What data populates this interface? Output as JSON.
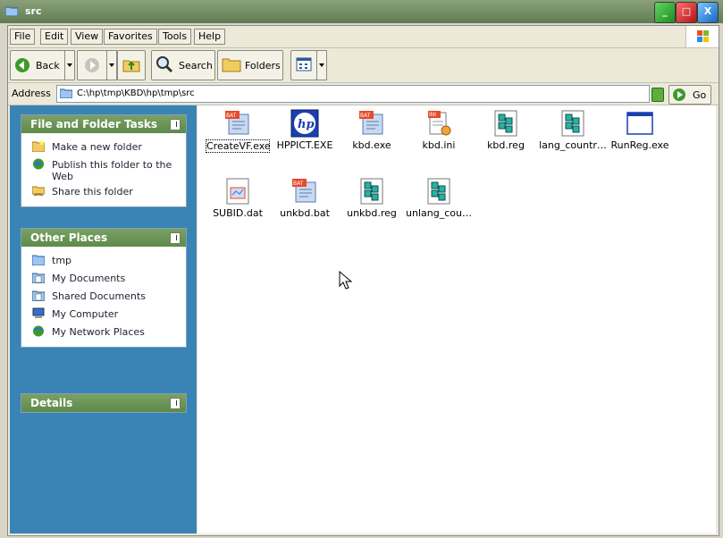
{
  "window": {
    "title": "src"
  },
  "menu": [
    "File",
    "Edit",
    "View",
    "Favorites",
    "Tools",
    "Help"
  ],
  "toolbar": {
    "back_label": "Back",
    "search_label": "Search",
    "folders_label": "Folders"
  },
  "address": {
    "label": "Address",
    "path": "C:\\hp\\tmp\\KBD\\hp\\tmp\\src",
    "go_label": "Go"
  },
  "panels": {
    "tasks": {
      "title": "File and Folder Tasks",
      "items": [
        {
          "label": "Make a new folder",
          "icon": "new-folder-icon"
        },
        {
          "label": "Publish this folder to the Web",
          "icon": "publish-web-icon"
        },
        {
          "label": "Share this folder",
          "icon": "share-folder-icon"
        }
      ]
    },
    "places": {
      "title": "Other Places",
      "items": [
        {
          "label": "tmp",
          "icon": "folder-icon"
        },
        {
          "label": "My Documents",
          "icon": "my-documents-icon"
        },
        {
          "label": "Shared Documents",
          "icon": "shared-documents-icon"
        },
        {
          "label": "My Computer",
          "icon": "my-computer-icon"
        },
        {
          "label": "My Network Places",
          "icon": "network-places-icon"
        }
      ]
    },
    "details": {
      "title": "Details"
    }
  },
  "files": [
    {
      "name": "CreateVF.exe",
      "icon": "batch-file-icon",
      "selected": true
    },
    {
      "name": "HPPICT.EXE",
      "icon": "hp-logo-icon"
    },
    {
      "name": "kbd.exe",
      "icon": "batch-file-icon"
    },
    {
      "name": "kbd.ini",
      "icon": "ini-file-icon"
    },
    {
      "name": "kbd.reg",
      "icon": "registry-file-icon"
    },
    {
      "name": "lang_countr…",
      "icon": "registry-file-icon"
    },
    {
      "name": "RunReg.exe",
      "icon": "application-window-icon"
    },
    {
      "name": "SUBID.dat",
      "icon": "data-file-icon"
    },
    {
      "name": "unkbd.bat",
      "icon": "batch-file-icon"
    },
    {
      "name": "unkbd.reg",
      "icon": "registry-file-icon"
    },
    {
      "name": "unlang_cou…",
      "icon": "registry-file-icon"
    }
  ],
  "colors": {
    "task_pane": "#3a83b5",
    "panel_header": "#6a9355",
    "titlebar": "#6f8d60"
  }
}
